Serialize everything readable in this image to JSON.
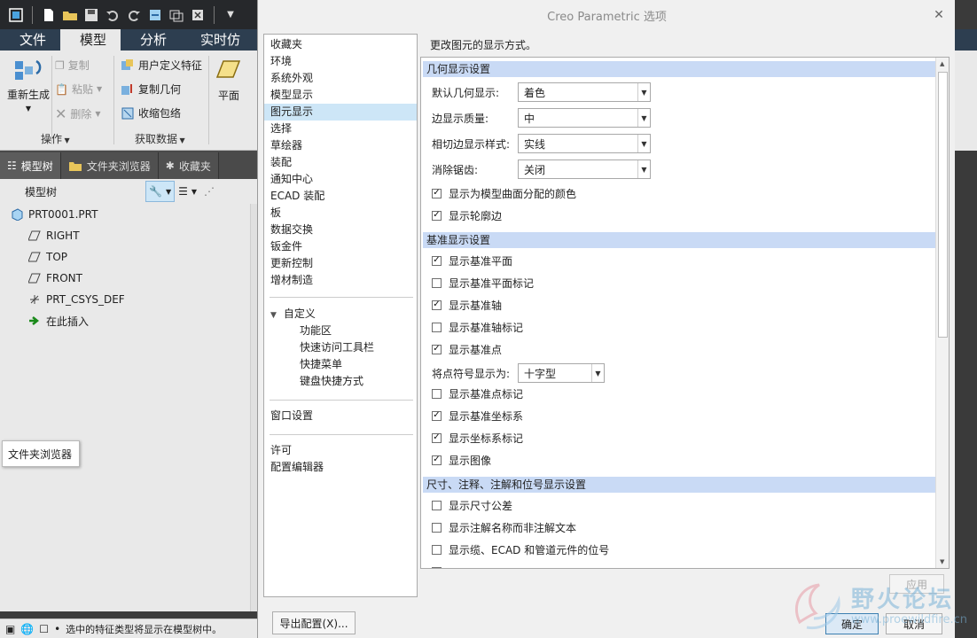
{
  "main_window": {
    "ribbon_tabs": [
      {
        "label": "文件"
      },
      {
        "label": "模型"
      },
      {
        "label": "分析"
      },
      {
        "label": "实时仿"
      }
    ],
    "ribbon": {
      "regenerate": "重新生成",
      "copy": "复制",
      "paste": "粘贴",
      "delete": "删除",
      "user_defined_feature": "用户定义特征",
      "copy_geometry": "复制几何",
      "shrinkwrap": "收缩包络",
      "plane": "平面",
      "group_operations": "操作",
      "group_get_data": "获取数据"
    },
    "panel_tabs": [
      {
        "label": "模型树"
      },
      {
        "label": "文件夹浏览器"
      },
      {
        "label": "收藏夹"
      }
    ],
    "tree_title": "模型树",
    "tree_items": [
      {
        "label": "PRT0001.PRT"
      },
      {
        "label": "RIGHT"
      },
      {
        "label": "TOP"
      },
      {
        "label": "FRONT"
      },
      {
        "label": "PRT_CSYS_DEF"
      },
      {
        "label": "在此插入"
      }
    ],
    "tooltip": "文件夹浏览器",
    "status_text": "选中的特征类型将显示在模型树中。"
  },
  "dialog": {
    "title": "Creo Parametric 选项",
    "nav_items": [
      {
        "label": "收藏夹"
      },
      {
        "label": "环境"
      },
      {
        "label": "系统外观"
      },
      {
        "label": "模型显示"
      },
      {
        "label": "图元显示"
      },
      {
        "label": "选择"
      },
      {
        "label": "草绘器"
      },
      {
        "label": "装配"
      },
      {
        "label": "通知中心"
      },
      {
        "label": "ECAD 装配"
      },
      {
        "label": "板"
      },
      {
        "label": "数据交换"
      },
      {
        "label": "钣金件"
      },
      {
        "label": "更新控制"
      },
      {
        "label": "增材制造"
      }
    ],
    "customize": {
      "label": "自定义",
      "children": [
        {
          "label": "功能区"
        },
        {
          "label": "快速访问工具栏"
        },
        {
          "label": "快捷菜单"
        },
        {
          "label": "键盘快捷方式"
        }
      ]
    },
    "nav_bottom": [
      {
        "label": "窗口设置"
      },
      {
        "label": "许可"
      },
      {
        "label": "配置编辑器"
      }
    ],
    "content_heading": "更改图元的显示方式。",
    "sections": {
      "geometry": "几何显示设置",
      "datum": "基准显示设置",
      "dimension": "尺寸、注释、注解和位号显示设置"
    },
    "geometry_settings": [
      {
        "label": "默认几何显示:",
        "value": "着色"
      },
      {
        "label": "边显示质量:",
        "value": "中"
      },
      {
        "label": "相切边显示样式:",
        "value": "实线"
      },
      {
        "label": "消除锯齿:",
        "value": "关闭"
      }
    ],
    "geometry_checks": [
      {
        "label": "显示为模型曲面分配的颜色",
        "checked": true
      },
      {
        "label": "显示轮廓边",
        "checked": true
      }
    ],
    "datum_checks": [
      {
        "label": "显示基准平面",
        "checked": true
      },
      {
        "label": "显示基准平面标记",
        "checked": false
      },
      {
        "label": "显示基准轴",
        "checked": true
      },
      {
        "label": "显示基准轴标记",
        "checked": false
      },
      {
        "label": "显示基准点",
        "checked": true
      }
    ],
    "point_symbol": {
      "label": "将点符号显示为:",
      "value": "十字型"
    },
    "datum_checks_2": [
      {
        "label": "显示基准点标记",
        "checked": false
      },
      {
        "label": "显示基准坐标系",
        "checked": true
      },
      {
        "label": "显示坐标系标记",
        "checked": true
      },
      {
        "label": "显示图像",
        "checked": true
      }
    ],
    "dimension_checks": [
      {
        "label": "显示尺寸公差",
        "checked": false
      },
      {
        "label": "显示注解名称而非注解文本",
        "checked": false
      },
      {
        "label": "显示缆、ECAD 和管道元件的位号",
        "checked": false
      }
    ],
    "buttons": {
      "apply": "应用",
      "export": "导出配置(X)...",
      "ok": "确定",
      "cancel": "取消"
    }
  },
  "watermark": {
    "text": "野火论坛",
    "url": "www.proewildfire.cn"
  },
  "colors": {
    "ribbon_tab_bg": "#2d3e50",
    "section_header_bg": "#c9daf5",
    "selection_bg": "#cde6f7"
  }
}
